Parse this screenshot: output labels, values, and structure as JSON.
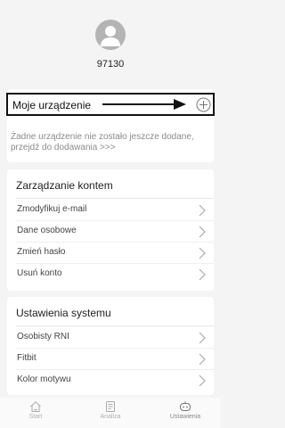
{
  "profile": {
    "user_id": "97130",
    "avatar_icon": "user-avatar-icon"
  },
  "device": {
    "title": "Moje urządzenie",
    "add_icon": "plus-circle-icon",
    "empty_text": "Żadne urządzenie nie zostało jeszcze dodane, przejdź do dodawania >>>"
  },
  "account": {
    "title": "Zarządzanie kontem",
    "items": [
      {
        "label": "Zmodyfikuj e-mail"
      },
      {
        "label": "Dane osobowe"
      },
      {
        "label": "Zmień hasło"
      },
      {
        "label": "Usuń konto"
      }
    ]
  },
  "system": {
    "title": "Ustawienia systemu",
    "items": [
      {
        "label": "Osobisty RNI"
      },
      {
        "label": "Fitbit"
      },
      {
        "label": "Kolor motywu"
      }
    ]
  },
  "tabs": [
    {
      "label": "Start",
      "icon": "home-icon"
    },
    {
      "label": "Analiza",
      "icon": "report-icon"
    },
    {
      "label": "Ustawienia",
      "icon": "robot-face-icon"
    }
  ],
  "colors": {
    "background": "#f4f4f4",
    "card": "#ffffff",
    "muted_text": "#8a8a8a",
    "highlight_border": "#111111"
  }
}
